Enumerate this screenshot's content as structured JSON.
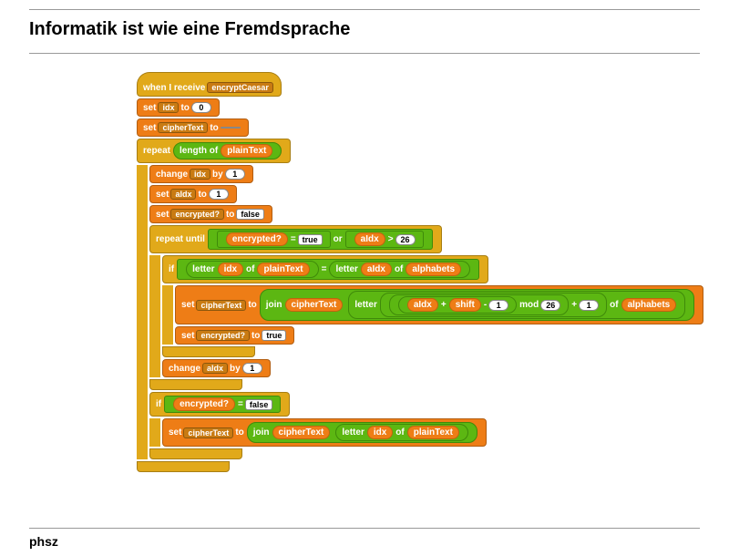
{
  "title": "Informatik ist wie eine Fremdsprache",
  "footer": "phsz",
  "e": {
    "when": "when I receive",
    "msg": "encryptCaesar",
    "set": "set",
    "to": "to",
    "change": "change",
    "by": "by",
    "idx": "idx",
    "cipher": "cipherText",
    "plain": "plainText",
    "aidx": "aIdx",
    "enc": "encrypted?",
    "alpha": "alphabets",
    "shift": "shift",
    "zero": "0",
    "one": "1",
    "n26": "26",
    "empty": " ",
    "true": "true",
    "false": "false",
    "repeat": "repeat",
    "lenof": "length of",
    "repuntil": "repeat until",
    "or": "or",
    "eq": "=",
    "gt": ">",
    "if": "if",
    "letter": "letter",
    "of": "of",
    "join": "join",
    "plus": "+",
    "minus": "-",
    "mod": "mod"
  }
}
